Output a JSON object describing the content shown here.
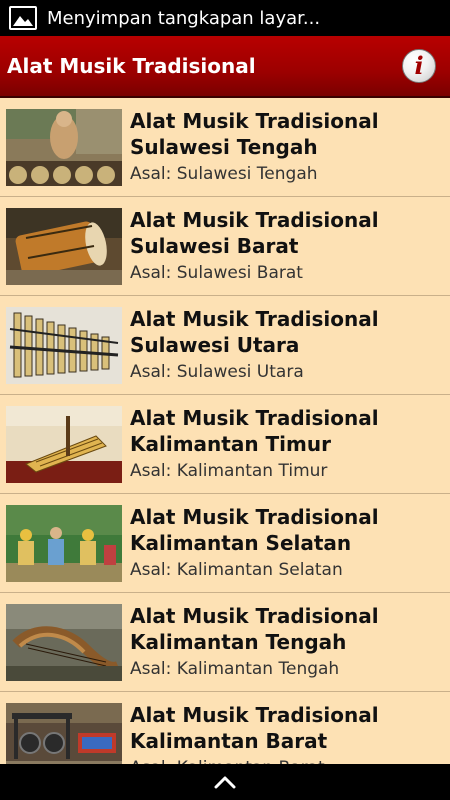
{
  "status_bar": {
    "notification_text": "Menyimpan tangkapan layar..."
  },
  "app_bar": {
    "title": "Alat Musik Tradisional",
    "info_icon_glyph": "i"
  },
  "list": {
    "items": [
      {
        "title_line1": "Alat Musik Tradisional",
        "title_line2": "Sulawesi Tengah",
        "subtitle": "Asal: Sulawesi Tengah"
      },
      {
        "title_line1": "Alat Musik Tradisional",
        "title_line2": "Sulawesi Barat",
        "subtitle": "Asal: Sulawesi Barat"
      },
      {
        "title_line1": "Alat Musik Tradisional",
        "title_line2": "Sulawesi Utara",
        "subtitle": "Asal: Sulawesi Utara"
      },
      {
        "title_line1": "Alat Musik Tradisional",
        "title_line2": "Kalimantan Timur",
        "subtitle": "Asal: Kalimantan Timur"
      },
      {
        "title_line1": "Alat Musik Tradisional",
        "title_line2": "Kalimantan Selatan",
        "subtitle": "Asal: Kalimantan Selatan"
      },
      {
        "title_line1": "Alat Musik Tradisional",
        "title_line2": "Kalimantan Tengah",
        "subtitle": "Asal: Kalimantan Tengah"
      },
      {
        "title_line1": "Alat Musik Tradisional",
        "title_line2": "Kalimantan Barat",
        "subtitle": "Asal: Kalimantan Barat"
      }
    ]
  },
  "colors": {
    "app_bar": "#a00000",
    "list_background": "#fde1b4",
    "divider": "#c9b08a"
  },
  "icons": {
    "status": "image-icon",
    "info": "info-icon",
    "nav": "chevron-up-icon"
  }
}
